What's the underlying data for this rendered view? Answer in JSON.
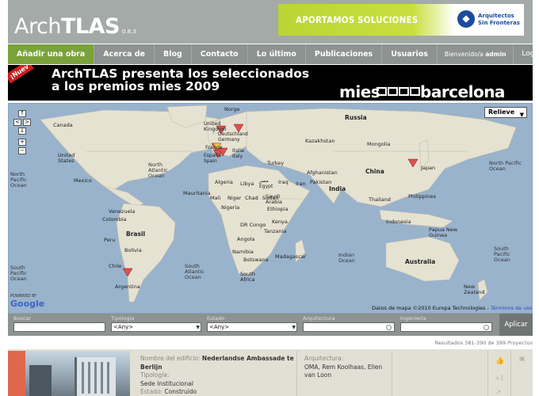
{
  "header": {
    "logo_light": "Arch",
    "logo_bold": "TLAS",
    "version": "0.8.3",
    "ad_text": "APORTAMOS SOLUCIONES",
    "ad_org_line1": "Arquitectos",
    "ad_org_line2": "Sin Fronteras"
  },
  "nav": {
    "items": [
      {
        "label": "Añadir una obra",
        "active": true
      },
      {
        "label": "Acerca de"
      },
      {
        "label": "Blog"
      },
      {
        "label": "Contacto"
      },
      {
        "label": "Lo último"
      },
      {
        "label": "Publicaciones"
      },
      {
        "label": "Usuarios"
      }
    ],
    "welcome_prefix": "Bienvenido/a",
    "username": "admin",
    "logout": "Logout"
  },
  "banner": {
    "badge": "¡Nuev",
    "title_line1": "ArchTLAS presenta los seleccionados",
    "title_line2": "a los premios mies 2009",
    "mies": "mies",
    "barcelona": "barcelona"
  },
  "map": {
    "relief_label": "Relieve",
    "attribution": "Datos de mapa ©2010 Europa Technologies -",
    "terms": "Términos de uso",
    "powered_by": "POWERED BY",
    "google": "Google",
    "labels": {
      "canada": "Canada",
      "us": "United States",
      "mexico": "Mexico",
      "nap": "North Pacific Ocean",
      "nao": "North Atlantic Ocean",
      "venezuela": "Venezuela",
      "colombia": "Colombia",
      "peru": "Peru",
      "brasil": "Brasil",
      "bolivia": "Bolivia",
      "chile": "Chile",
      "argentina": "Argentina",
      "sap": "South Pacific Ocean",
      "sao": "South Atlantic Ocean",
      "norge": "Norge",
      "uk": "United Kingdom",
      "deutsch": "Deutschland",
      "germany": "Germany",
      "france": "France",
      "espana": "España",
      "spain": "Spain",
      "italia": "Italia",
      "italy": "Italy",
      "russia": "Russia",
      "kazakhstan": "Kazakhstan",
      "mongolia": "Mongolia",
      "china": "China",
      "japan": "Japan",
      "turkey": "Turkey",
      "iraq": "Iraq",
      "iran": "Iran",
      "afghanistan": "Afghanistan",
      "pakistan": "Pakistan",
      "india": "India",
      "saudi": "Saudi Arabia",
      "algeria": "Algeria",
      "libya": "Libya",
      "egypt_ar": "مصر",
      "egypt": "Egypt",
      "mali": "Mali",
      "niger": "Niger",
      "chad": "Chad",
      "sudan": "Sudan",
      "mauritania": "Mauritania",
      "nigeria": "Nigeria",
      "ethiopia": "Ethiopia",
      "drc": "DR Congo",
      "kenya": "Kenya",
      "tanzania": "Tanzania",
      "angola": "Angola",
      "namibia": "Namibia",
      "botswana": "Botswana",
      "southafrica": "South Africa",
      "madagascar": "Madagascar",
      "thailand": "Thailand",
      "philippines": "Philippines",
      "indonesia": "Indonesia",
      "png": "Papua New Guinea",
      "australia": "Australia",
      "nz": "New Zealand",
      "indian_ocean": "Indian Ocean",
      "npo_east": "North Pacific Ocean",
      "spo_east": "South Pacific Ocean"
    }
  },
  "filters": {
    "buscar_label": "Buscar",
    "buscar_value": "",
    "tipologia_label": "Tipología",
    "tipologia_value": "<Any>",
    "estado_label": "Estado",
    "estado_value": "<Any>",
    "arquitectura_label": "Arquitectura",
    "arquitectura_value": "",
    "ingenieria_label": "Ingeniería",
    "ingenieria_value": "",
    "apply": "Aplicar"
  },
  "results": {
    "text": "Resultados 381-390 de 399",
    "unit": "Proyectos"
  },
  "card": {
    "name_label": "Nombre del edificio:",
    "name_value": "Nederlandse Ambassade te Berlijn",
    "tipologia_label": "Tipología:",
    "tipologia_value": "Sede Institucional",
    "estado_label": "Estado:",
    "estado_value": "Construido",
    "arq_label": "Arquitectura:",
    "arq_value": "OMA, Rem Koolhaas, Ellen van Loon",
    "plus_one": "+1"
  },
  "colors": {
    "header_gray": "#a4aaa7",
    "nav_gray": "#8d9390",
    "active_green": "#7aa23b",
    "ocean": "#99b3cc",
    "land": "#e8e4d6",
    "marker": "#d9534f",
    "card_bg": "#e2e0d5",
    "card_accent": "#e0674e"
  }
}
